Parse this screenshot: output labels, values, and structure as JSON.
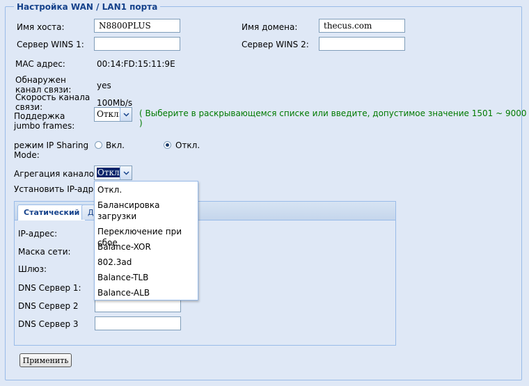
{
  "section": {
    "title": "Настройка WAN / LAN1 порта"
  },
  "fields": {
    "hostname": {
      "label": "Имя хоста:",
      "value": "N8800PLUS"
    },
    "domain": {
      "label": "Имя домена:",
      "value": "thecus.com"
    },
    "wins1": {
      "label": "Сервер WINS 1:",
      "value": ""
    },
    "wins2": {
      "label": "Сервер WINS 2:",
      "value": ""
    },
    "mac": {
      "label": "MAC адрес:",
      "value": "00:14:FD:15:11:9E"
    },
    "link_detected": {
      "label": "Обнаружен канал связи:",
      "value": "yes"
    },
    "link_speed": {
      "label": "Скорость канала связи:",
      "value": "100Mb/s"
    },
    "jumbo": {
      "label": "Поддержка jumbo frames:",
      "value": "Откл.",
      "hint": "( Выберите в раскрывающемся списке или введите, допустимое значение 1501 ~ 9000 )"
    },
    "ip_sharing": {
      "label": "режим IP Sharing Mode:",
      "option_on": "Вкл.",
      "option_off": "Откл.",
      "selected": "Откл."
    },
    "aggregation": {
      "label": "Агрегация каналов:",
      "value": "Откл.",
      "options": [
        "Откл.",
        "Балансировка загрузки",
        "Переключение при сбое",
        "Balance-XOR",
        "802.3ad",
        "Balance-TLB",
        "Balance-ALB"
      ]
    },
    "set_ip": {
      "label": "Установить IP-адрес"
    }
  },
  "tabs": [
    {
      "label": "Статический",
      "active": true
    },
    {
      "label": "Д",
      "active": false
    }
  ],
  "static": {
    "ip": {
      "label": "IP-адрес:"
    },
    "mask": {
      "label": "Маска сети:"
    },
    "gateway": {
      "label": "Шлюз:"
    },
    "dns1": {
      "label": "DNS Сервер 1:"
    },
    "dns2": {
      "label": "DNS Сервер 2",
      "value": ""
    },
    "dns3": {
      "label": "DNS Сервер 3",
      "value": ""
    }
  },
  "actions": {
    "apply": "Применить"
  },
  "colors": {
    "background": "#dfe8f6",
    "border": "#99bbe8",
    "hint": "#007a00",
    "title": "#15428b"
  }
}
